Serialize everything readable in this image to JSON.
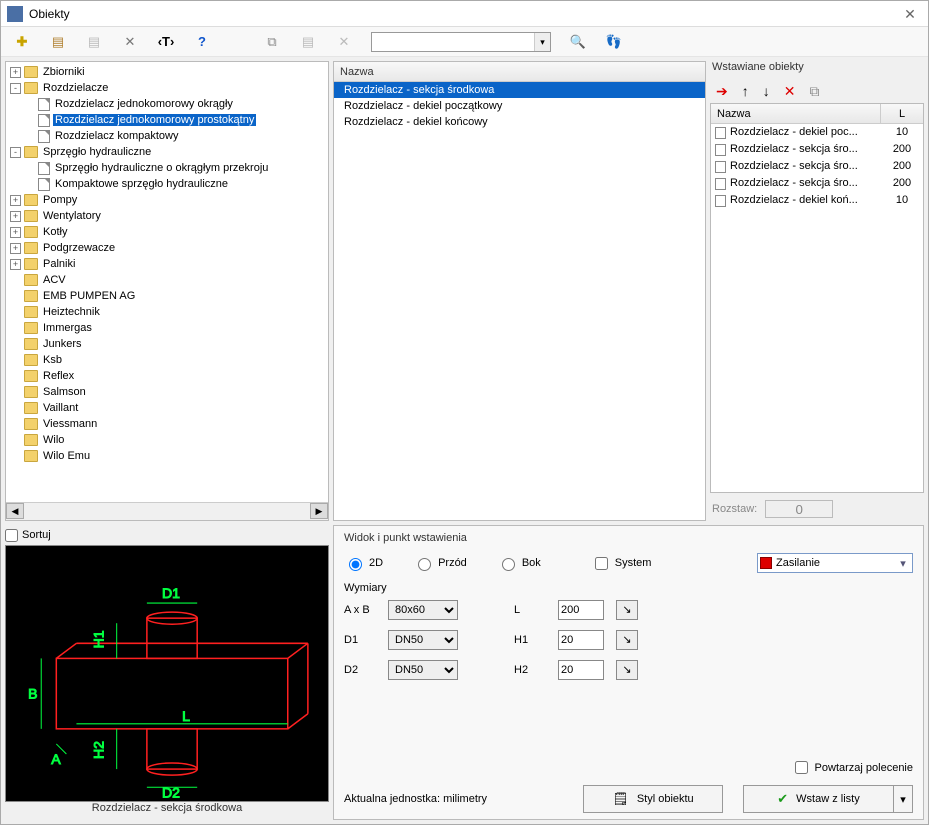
{
  "window": {
    "title": "Obiekty"
  },
  "toolbar": {
    "search_value": ""
  },
  "tree": {
    "nodes": [
      {
        "label": "Zbiorniki",
        "type": "folder",
        "exp": "+",
        "children": []
      },
      {
        "label": "Rozdzielacze",
        "type": "folder",
        "exp": "-",
        "children": [
          {
            "label": "Rozdzielacz jednokomorowy okrągły",
            "type": "doc"
          },
          {
            "label": "Rozdzielacz jednokomorowy prostokątny",
            "type": "doc",
            "selected": true
          },
          {
            "label": "Rozdzielacz kompaktowy",
            "type": "doc"
          }
        ]
      },
      {
        "label": "Sprzęgło hydrauliczne",
        "type": "folder",
        "exp": "-",
        "children": [
          {
            "label": "Sprzęgło hydrauliczne o okrągłym przekroju",
            "type": "doc"
          },
          {
            "label": "Kompaktowe sprzęgło hydrauliczne",
            "type": "doc"
          }
        ]
      },
      {
        "label": "Pompy",
        "type": "folder",
        "exp": "+"
      },
      {
        "label": "Wentylatory",
        "type": "folder",
        "exp": "+"
      },
      {
        "label": "Kotły",
        "type": "folder",
        "exp": "+"
      },
      {
        "label": "Podgrzewacze",
        "type": "folder",
        "exp": "+"
      },
      {
        "label": "Palniki",
        "type": "folder",
        "exp": "+"
      },
      {
        "label": "ACV",
        "type": "folder"
      },
      {
        "label": "EMB PUMPEN AG",
        "type": "folder"
      },
      {
        "label": "Heiztechnik",
        "type": "folder"
      },
      {
        "label": "Immergas",
        "type": "folder"
      },
      {
        "label": "Junkers",
        "type": "folder"
      },
      {
        "label": "Ksb",
        "type": "folder"
      },
      {
        "label": "Reflex",
        "type": "folder"
      },
      {
        "label": "Salmson",
        "type": "folder"
      },
      {
        "label": "Vaillant",
        "type": "folder"
      },
      {
        "label": "Viessmann",
        "type": "folder"
      },
      {
        "label": "Wilo",
        "type": "folder"
      },
      {
        "label": "Wilo Emu",
        "type": "folder"
      }
    ]
  },
  "sort": {
    "label": "Sortuj",
    "checked": false
  },
  "middle": {
    "header": "Nazwa",
    "items": [
      {
        "label": "Rozdzielacz - sekcja środkowa",
        "selected": true
      },
      {
        "label": "Rozdzielacz - dekiel początkowy"
      },
      {
        "label": "Rozdzielacz - dekiel końcowy"
      }
    ]
  },
  "right": {
    "title": "Wstawiane obiekty",
    "header": {
      "name": "Nazwa",
      "l": "L"
    },
    "rows": [
      {
        "name": "Rozdzielacz - dekiel poc...",
        "l": "10"
      },
      {
        "name": "Rozdzielacz - sekcja śro...",
        "l": "200"
      },
      {
        "name": "Rozdzielacz - sekcja śro...",
        "l": "200"
      },
      {
        "name": "Rozdzielacz - sekcja śro...",
        "l": "200"
      },
      {
        "name": "Rozdzielacz - dekiel koń...",
        "l": "10"
      }
    ],
    "spacing_label": "Rozstaw:",
    "spacing_value": "0"
  },
  "preview": {
    "caption": "Rozdzielacz - sekcja środkowa",
    "labels": {
      "A": "A",
      "B": "B",
      "L": "L",
      "D1": "D1",
      "D2": "D2",
      "H1": "H1",
      "H2": "H2"
    }
  },
  "props": {
    "section_title": "Widok i punkt wstawienia",
    "views": {
      "v2d": "2D",
      "front": "Przód",
      "side": "Bok",
      "system": "System"
    },
    "zas": "Zasilanie",
    "dims_title": "Wymiary",
    "labels": {
      "AB": "A x B",
      "D1": "D1",
      "D2": "D2",
      "L": "L",
      "H1": "H1",
      "H2": "H2"
    },
    "values": {
      "AB": "80x60",
      "D1": "DN50",
      "D2": "DN50",
      "L": "200",
      "H1": "20",
      "H2": "20"
    },
    "repeat": "Powtarzaj polecenie",
    "unit_label": "Aktualna jednostka: milimetry",
    "style_btn": "Styl obiektu",
    "insert_btn": "Wstaw z listy"
  }
}
